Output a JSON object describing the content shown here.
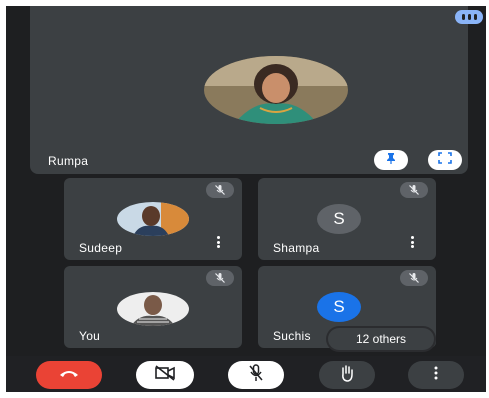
{
  "main_speaker": {
    "name": "Rumpa"
  },
  "tiles": [
    {
      "name": "Sudeep",
      "avatar_type": "photo"
    },
    {
      "name": "Shampa",
      "avatar_type": "letter",
      "initial": "S",
      "avatar_color": "#5f6368"
    },
    {
      "name": "You",
      "avatar_type": "photo"
    },
    {
      "name": "Suchis",
      "avatar_type": "letter",
      "initial": "S",
      "avatar_color": "#1a73e8"
    }
  ],
  "others_label": "12 others",
  "colors": {
    "background": "#1e1f21",
    "tile": "#3c4043",
    "end_call": "#ea4335",
    "active_blue": "#8ab4f8"
  },
  "controls": [
    {
      "icon": "end-call-icon"
    },
    {
      "icon": "camera-off-icon"
    },
    {
      "icon": "mic-off-icon"
    },
    {
      "icon": "raise-hand-icon"
    },
    {
      "icon": "more-options-icon"
    }
  ]
}
